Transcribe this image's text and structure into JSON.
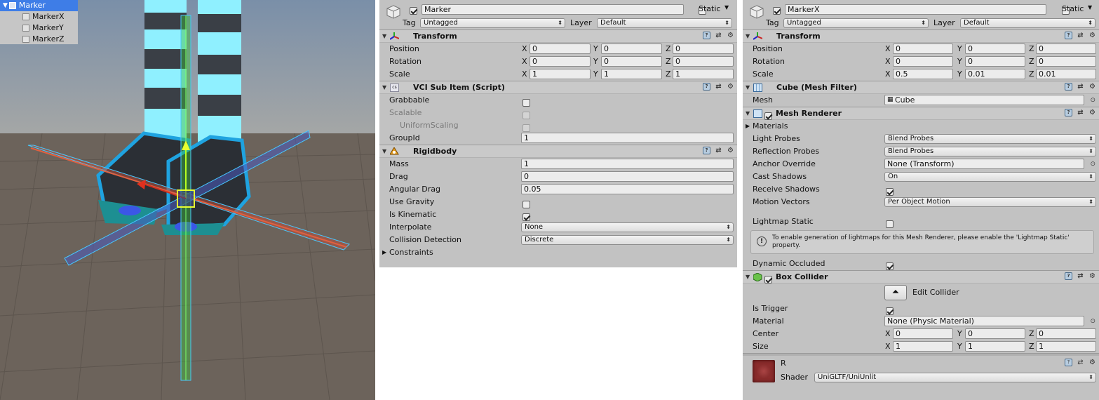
{
  "hierarchy": {
    "items": [
      {
        "label": "Marker"
      },
      {
        "label": "MarkerX"
      },
      {
        "label": "MarkerY"
      },
      {
        "label": "MarkerZ"
      }
    ]
  },
  "panel1": {
    "name": "Marker",
    "static_label": "Static",
    "tag_label": "Tag",
    "tag_value": "Untagged",
    "layer_label": "Layer",
    "layer_value": "Default",
    "transform": {
      "title": "Transform",
      "position_label": "Position",
      "position": [
        "0",
        "0",
        "0"
      ],
      "rotation_label": "Rotation",
      "rotation": [
        "0",
        "0",
        "0"
      ],
      "scale_label": "Scale",
      "scale": [
        "1",
        "1",
        "1"
      ]
    },
    "vci": {
      "title": "VCI Sub Item (Script)",
      "grabbable": "Grabbable",
      "scalable": "Scalable",
      "uniform_scaling": "UniformScaling",
      "group_id_label": "GroupId",
      "group_id": "1"
    },
    "rigidbody": {
      "title": "Rigidbody",
      "mass_label": "Mass",
      "mass": "1",
      "drag_label": "Drag",
      "drag": "0",
      "angular_drag_label": "Angular Drag",
      "angular_drag": "0.05",
      "use_gravity": "Use Gravity",
      "is_kinematic": "Is Kinematic",
      "interpolate_label": "Interpolate",
      "interpolate": "None",
      "collision_label": "Collision Detection",
      "collision": "Discrete",
      "constraints": "Constraints"
    }
  },
  "panel2": {
    "name": "MarkerX",
    "static_label": "Static",
    "tag_label": "Tag",
    "tag_value": "Untagged",
    "layer_label": "Layer",
    "layer_value": "Default",
    "transform": {
      "title": "Transform",
      "position_label": "Position",
      "position": [
        "0",
        "0",
        "0"
      ],
      "rotation_label": "Rotation",
      "rotation": [
        "0",
        "0",
        "0"
      ],
      "scale_label": "Scale",
      "scale": [
        "0.5",
        "0.01",
        "0.01"
      ]
    },
    "mesh_filter": {
      "title": "Cube (Mesh Filter)",
      "mesh_label": "Mesh",
      "mesh": "Cube"
    },
    "mesh_renderer": {
      "title": "Mesh Renderer",
      "materials": "Materials",
      "light_probes_label": "Light Probes",
      "light_probes": "Blend Probes",
      "reflection_probes_label": "Reflection Probes",
      "reflection_probes": "Blend Probes",
      "anchor_override_label": "Anchor Override",
      "anchor_override": "None (Transform)",
      "cast_shadows_label": "Cast Shadows",
      "cast_shadows": "On",
      "receive_shadows": "Receive Shadows",
      "motion_vectors_label": "Motion Vectors",
      "motion_vectors": "Per Object Motion",
      "lightmap_static": "Lightmap Static",
      "help_text": "To enable generation of lightmaps for this Mesh Renderer, please enable the 'Lightmap Static' property.",
      "dynamic_occluded": "Dynamic Occluded"
    },
    "box_collider": {
      "title": "Box Collider",
      "edit_collider": "Edit Collider",
      "is_trigger": "Is Trigger",
      "material_label": "Material",
      "material": "None (Physic Material)",
      "center_label": "Center",
      "center": [
        "0",
        "0",
        "0"
      ],
      "size_label": "Size",
      "size": [
        "1",
        "1",
        "1"
      ]
    },
    "material": {
      "name": "R",
      "shader_label": "Shader",
      "shader": "UniGLTF/UniUnlit"
    }
  },
  "axis": {
    "x": "X",
    "y": "Y",
    "z": "Z"
  },
  "colors": {
    "selection": "#3e7de7",
    "inspector_bg": "#c2c2c2",
    "marker_x": "#c0503a",
    "marker_y": "#3fbf3f",
    "marker_z": "#4a5bbf"
  }
}
